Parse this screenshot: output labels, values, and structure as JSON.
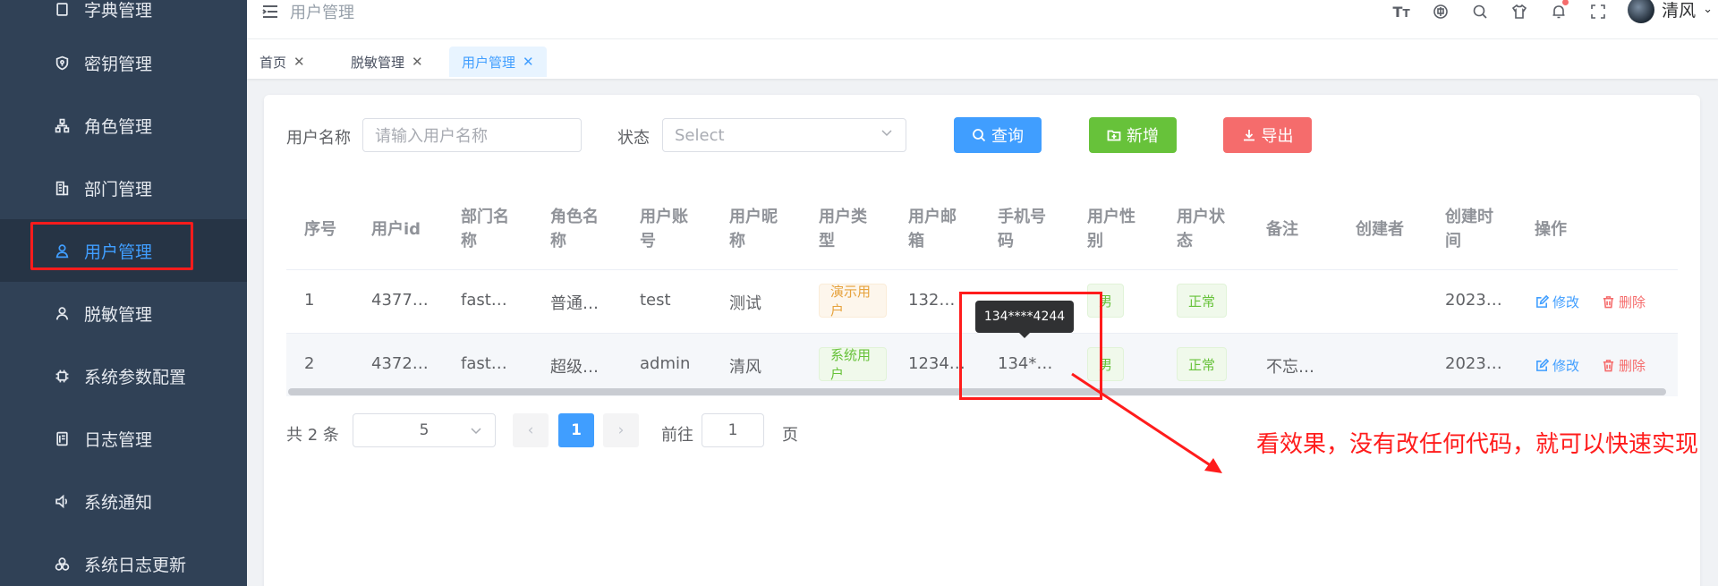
{
  "sidebar": {
    "items": [
      {
        "label": "字典管理",
        "icon": "book-icon"
      },
      {
        "label": "密钥管理",
        "icon": "key-shield-icon"
      },
      {
        "label": "角色管理",
        "icon": "role-tree-icon"
      },
      {
        "label": "部门管理",
        "icon": "building-icon"
      },
      {
        "label": "用户管理",
        "icon": "user-icon",
        "active": true
      },
      {
        "label": "脱敏管理",
        "icon": "user-outline-icon"
      },
      {
        "label": "系统参数配置",
        "icon": "gear-chip-icon"
      },
      {
        "label": "日志管理",
        "icon": "log-icon"
      },
      {
        "label": "系统通知",
        "icon": "speaker-icon"
      },
      {
        "label": "系统日志更新",
        "icon": "cluster-icon"
      }
    ]
  },
  "navbar": {
    "breadcrumb": "用户管理",
    "user_name": "清风",
    "icons": [
      "font-size-icon",
      "language-icon",
      "search-icon",
      "theme-shirt-icon",
      "bell-icon",
      "fullscreen-icon"
    ]
  },
  "tags": [
    {
      "label": "首页",
      "active": false
    },
    {
      "label": "脱敏管理",
      "active": false
    },
    {
      "label": "用户管理",
      "active": true
    }
  ],
  "filters": {
    "username_label": "用户名称",
    "username_placeholder": "请输入用户名称",
    "status_label": "状态",
    "status_placeholder": "Select",
    "query_label": "查询",
    "add_label": "新增",
    "export_label": "导出"
  },
  "table": {
    "headers": [
      "序号",
      "用户id",
      "部门名\n称",
      "角色名\n称",
      "用户账\n号",
      "用户昵\n称",
      "用户类\n型",
      "用户邮\n箱",
      "手机号\n码",
      "用户性\n别",
      "用户状\n态",
      "备注",
      "创建者",
      "创建时\n间",
      "操作"
    ],
    "rows": [
      {
        "index": "1",
        "id": "4377…",
        "dept": "fast…",
        "role": "普通…",
        "account": "test",
        "nickname": "测试",
        "type": "演示用户",
        "email": "132…",
        "phone": "",
        "sex": "男",
        "status": "正常",
        "remark": "",
        "creator": "",
        "created": "2023…"
      },
      {
        "index": "2",
        "id": "4372…",
        "dept": "fast…",
        "role": "超级…",
        "account": "admin",
        "nickname": "清风",
        "type": "系统用户",
        "email": "1234…",
        "phone": "134*…",
        "sex": "男",
        "status": "正常",
        "remark": "不忘…",
        "creator": "",
        "created": "2023…"
      }
    ],
    "edit_label": "修改",
    "delete_label": "删除"
  },
  "tooltip": "134****4244",
  "annotation": "看效果，没有改任何代码，就可以快速实现",
  "pagination": {
    "total": "共 2 条",
    "page_size": "5",
    "prev": "‹",
    "current": "1",
    "next": "›",
    "goto_label": "前往",
    "goto_value": "1",
    "page_suffix": "页"
  },
  "colors": {
    "sidebar_bg": "#304156",
    "primary": "#409eff",
    "success": "#67c23a",
    "danger": "#f56c6c",
    "annotation": "#ff1c1c"
  }
}
